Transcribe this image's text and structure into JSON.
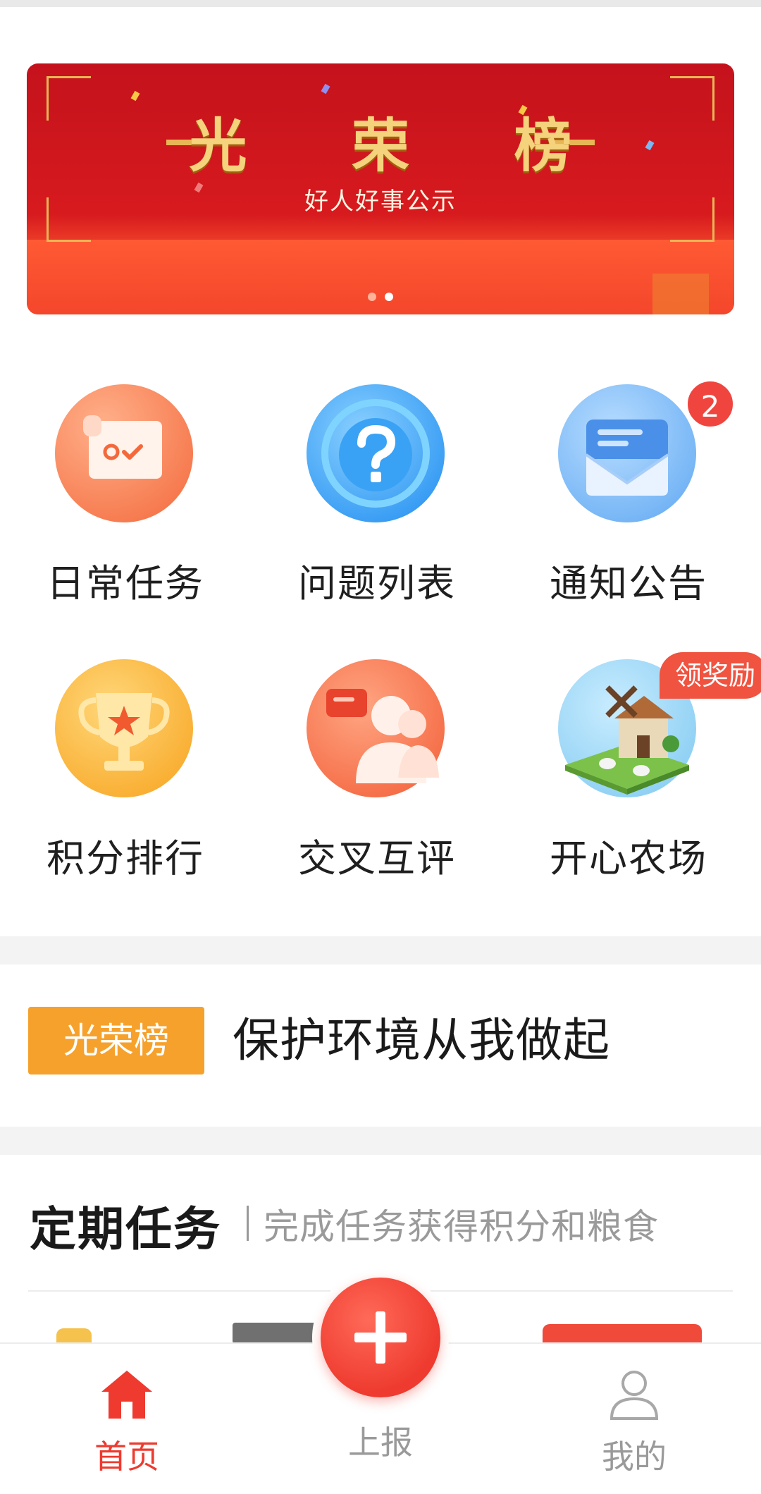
{
  "banner": {
    "title": "光 荣 榜",
    "subtitle": "好人好事公示",
    "page_count": 2,
    "active_page": 2
  },
  "menu": [
    {
      "label": "日常任务",
      "icon": "daily-task-icon"
    },
    {
      "label": "问题列表",
      "icon": "question-list-icon"
    },
    {
      "label": "通知公告",
      "icon": "notification-icon",
      "badge": "2"
    },
    {
      "label": "积分排行",
      "icon": "trophy-icon"
    },
    {
      "label": "交叉互评",
      "icon": "peer-review-icon"
    },
    {
      "label": "开心农场",
      "icon": "farm-icon",
      "badge": "领奖励"
    }
  ],
  "notice": {
    "tag": "光荣榜",
    "text": "保护环境从我做起"
  },
  "periodic": {
    "title": "定期任务",
    "subtitle": "完成任务获得积分和粮食"
  },
  "tabbar": {
    "home": "首页",
    "report": "上报",
    "mine": "我的",
    "active_color": "#ee3a2f",
    "inactive_color": "#9a9a9a"
  }
}
